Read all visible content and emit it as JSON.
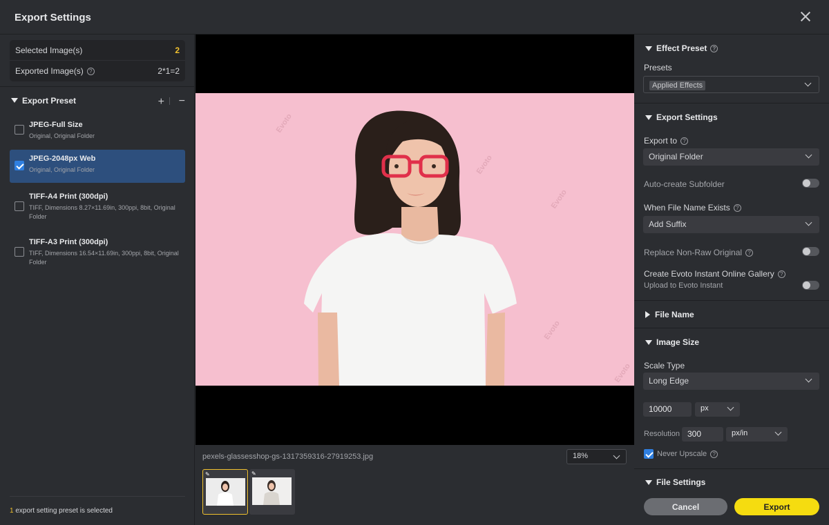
{
  "window": {
    "title": "Export Settings"
  },
  "stats": {
    "selected_label": "Selected Image(s)",
    "selected_value": "2",
    "exported_label": "Exported Image(s)",
    "exported_value": "2*1=2"
  },
  "export_preset": {
    "header": "Export Preset",
    "items": [
      {
        "name": "JPEG-Full Size",
        "detail": "Original, Original Folder",
        "checked": false
      },
      {
        "name": "JPEG-2048px Web",
        "detail": "Original, Original Folder",
        "checked": true
      },
      {
        "name": "TIFF-A4 Print (300dpi)",
        "detail": "TIFF, Dimensions 8.27×11.69in, 300ppi, 8bit, Original Folder",
        "checked": false
      },
      {
        "name": "TIFF-A3 Print (300dpi)",
        "detail": "TIFF, Dimensions 16.54×11.69in, 300ppi, 8bit, Original Folder",
        "checked": false
      }
    ],
    "footer_count": "1",
    "footer_text": "export setting preset is selected"
  },
  "preview": {
    "filename": "pexels-glassesshop-gs-1317359316-27919253.jpg",
    "zoom": "18%",
    "watermark": "Evoto"
  },
  "right": {
    "effect_preset": {
      "header": "Effect Preset",
      "presets_label": "Presets",
      "presets_value": "Applied Effects"
    },
    "export_settings": {
      "header": "Export Settings",
      "export_to_label": "Export to",
      "export_to_value": "Original Folder",
      "auto_subfolder": "Auto-create Subfolder",
      "file_exists_label": "When File Name Exists",
      "file_exists_value": "Add Suffix",
      "replace_label": "Replace Non-Raw Original",
      "gallery_label": "Create Evoto Instant Online Gallery",
      "gallery_sub": "Upload to Evoto Instant"
    },
    "file_name": {
      "header": "File Name"
    },
    "image_size": {
      "header": "Image Size",
      "scale_label": "Scale Type",
      "scale_value": "Long Edge",
      "size_value": "10000",
      "size_unit": "px",
      "resolution_label": "Resolution",
      "resolution_value": "300",
      "resolution_unit": "px/in",
      "never_upscale": "Never Upscale"
    },
    "file_settings": {
      "header": "File Settings"
    },
    "cancel": "Cancel",
    "export": "Export"
  },
  "colors": {
    "accent_yellow": "#f5dc10",
    "selection_blue": "#2d4f7d",
    "checkbox_blue": "#2f7fe0"
  }
}
